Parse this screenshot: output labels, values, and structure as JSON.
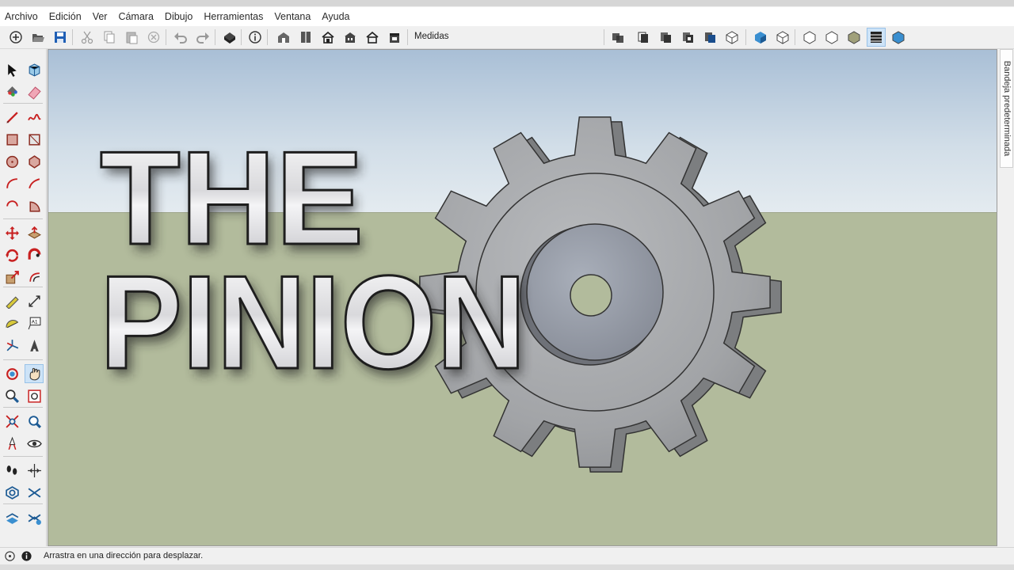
{
  "menu": [
    "Archivo",
    "Edición",
    "Ver",
    "Cámara",
    "Dibujo",
    "Herramientas",
    "Ventana",
    "Ayuda"
  ],
  "toolbar": {
    "measurements_label": "Medidas",
    "icons": [
      "new-icon",
      "open-icon",
      "save-icon",
      "cut-icon",
      "copy-icon",
      "paste-icon",
      "erase-icon",
      "undo-icon",
      "redo-icon",
      "print-icon",
      "model-info-icon",
      "views-iso-icon",
      "views-top-icon",
      "views-front-icon",
      "views-right-icon",
      "views-back-icon",
      "views-left-icon",
      "xray-icon",
      "back-edges-icon",
      "wireframe-icon",
      "hidden-line-icon",
      "shaded-icon",
      "shaded-textures-icon",
      "monochrome-icon"
    ],
    "active_icon": "shaded-textures-icon"
  },
  "left_toolbar": {
    "icons": [
      "select-icon",
      "component-icon",
      "paint-bucket-icon",
      "eraser-icon",
      "line-icon",
      "freehand-icon",
      "rectangle-icon",
      "rotated-rectangle-icon",
      "circle-icon",
      "polygon-icon",
      "arc-icon",
      "two-point-arc-icon",
      "three-point-arc-icon",
      "pie-icon",
      "move-icon",
      "push-pull-icon",
      "rotate-icon",
      "follow-me-icon",
      "scale-icon",
      "offset-icon",
      "tape-measure-icon",
      "dimension-icon",
      "protractor-icon",
      "text-icon",
      "axes-icon",
      "3d-text-icon",
      "orbit-icon",
      "pan-icon",
      "zoom-icon",
      "zoom-window-icon",
      "zoom-extents-icon",
      "previous-view-icon",
      "position-camera-icon",
      "look-around-icon",
      "walk-icon",
      "section-plane-icon",
      "sandbox-from-contours-icon",
      "sandbox-from-scratch-icon",
      "smoove-icon",
      "stamp-icon"
    ],
    "active_icon": "pan-icon"
  },
  "viewport": {
    "title_line1": "THE",
    "title_line2": "PINION",
    "colors": {
      "sky_top": "#a9bfd6",
      "sky_bottom": "#e4ebf0",
      "ground": "#b2bb9c",
      "gear_face": "#a5a7a9",
      "gear_side": "#7c7e80",
      "text_fill": "#e6e6e6"
    }
  },
  "tray": {
    "label": "Bandeja predeterminada"
  },
  "status": {
    "text": "Arrastra en una dirección para desplazar.",
    "icons": [
      "geo-location-icon",
      "credits-icon"
    ]
  }
}
